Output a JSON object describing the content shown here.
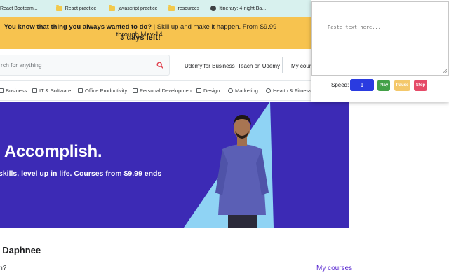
{
  "bookmarks": [
    {
      "label": "React Bootcam...",
      "icon": "folder-icon"
    },
    {
      "label": "React practice",
      "icon": "folder-icon"
    },
    {
      "label": "javascript practice",
      "icon": "folder-icon"
    },
    {
      "label": "resources",
      "icon": "folder-icon"
    },
    {
      "label": "Itinerary: 4-night Ba...",
      "icon": "globe-icon"
    }
  ],
  "promo": {
    "bold_text": "You know that thing you always wanted to do?",
    "rest_text": " | Skill up and make it happen. From $9.99 through May 14.",
    "countdown": "3 days left!"
  },
  "header": {
    "search_placeholder": "rch for anything",
    "links": [
      "Udemy for Business",
      "Teach on Udemy",
      "My course"
    ]
  },
  "categories": [
    "Business",
    "IT & Software",
    "Office Productivity",
    "Personal Development",
    "Design",
    "Marketing",
    "Health & Fitness"
  ],
  "hero": {
    "title": ". Accomplish.",
    "subtitle": "skills, level up in life. Courses from $9.99 ends"
  },
  "welcome": {
    "greeting": ", Daphnee",
    "prompt": "in?",
    "my_courses_link": "My courses"
  },
  "popup": {
    "placeholder": "Paste text here...",
    "speed_label": "Speed:",
    "speed_value": "1",
    "buttons": {
      "play": "Play",
      "pause": "Pause",
      "stop": "Stop"
    }
  },
  "colors": {
    "promo_bg": "#f7c34f",
    "hero_bg": "#3c2ab5",
    "hero_accent": "#8fd3f4",
    "link": "#5624d0",
    "play": "#43a047",
    "pause": "#f4c86b",
    "stop": "#e54b68"
  }
}
